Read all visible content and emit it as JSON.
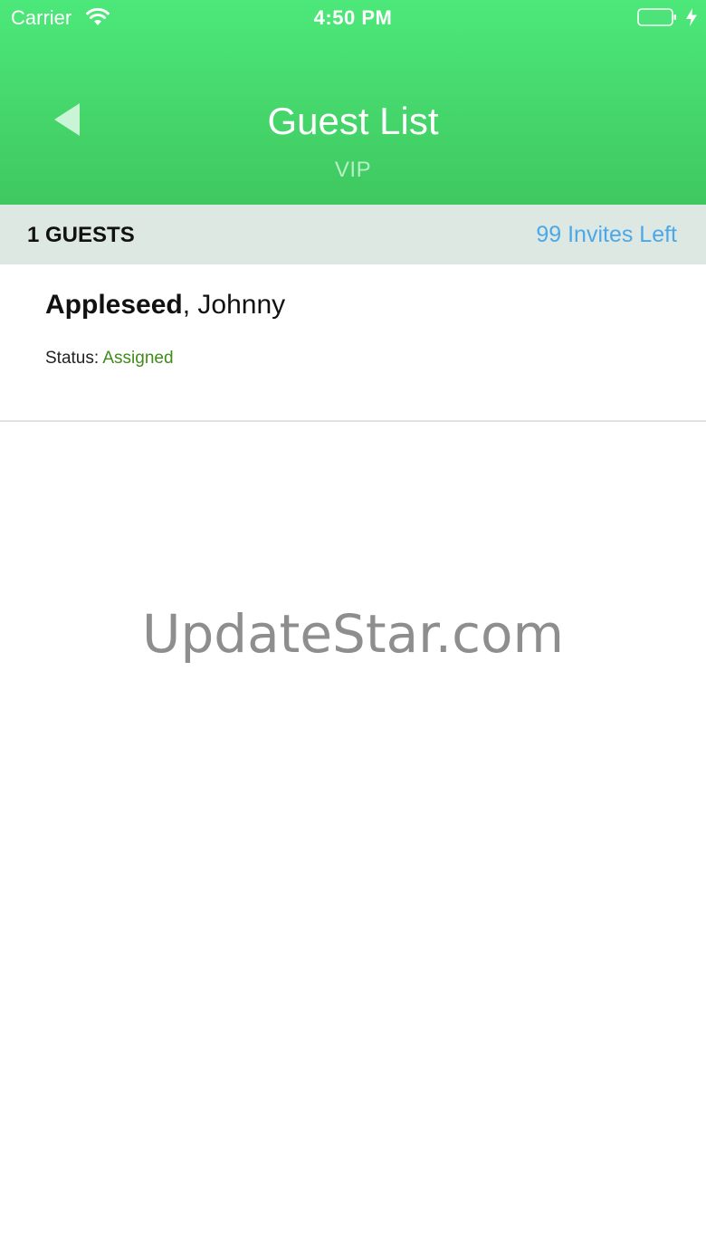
{
  "status_bar": {
    "carrier": "Carrier",
    "time": "4:50 PM",
    "icons": [
      "wifi-icon",
      "battery-icon",
      "charging-bolt-icon"
    ]
  },
  "header": {
    "title": "Guest List",
    "subtitle": "VIP",
    "back_icon": "back-triangle-icon"
  },
  "section": {
    "guest_count": "1 GUESTS",
    "invites_left": "99 Invites Left"
  },
  "guests": [
    {
      "last_name": "Appleseed",
      "separator": ", ",
      "first_name": "Johnny",
      "status_label": "Status: ",
      "status_value": "Assigned"
    }
  ],
  "watermark": "UpdateStar.com",
  "colors": {
    "header_top": "#4de87a",
    "header_bottom": "#3fc85f",
    "section_bar": "#dde8e3",
    "invites_link": "#4aa8ea",
    "status_assigned": "#3f8c1a"
  }
}
